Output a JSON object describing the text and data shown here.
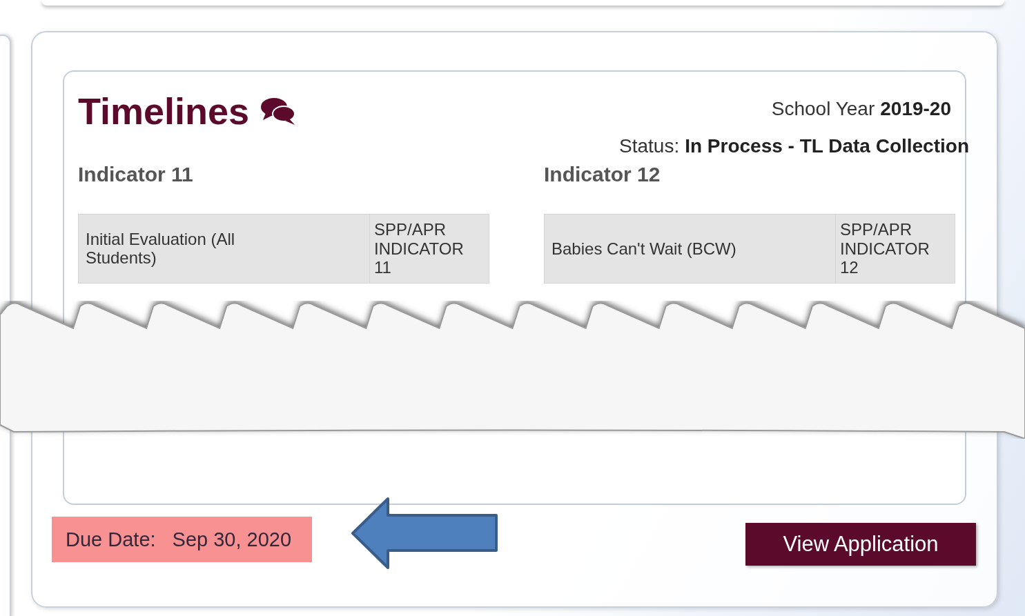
{
  "timelines": {
    "title": "Timelines",
    "school_year": {
      "label": "School Year",
      "value": "2019-20"
    },
    "status": {
      "label": "Status:",
      "value": "In Process - TL Data Collection"
    },
    "indicators": [
      {
        "title": "Indicator 11",
        "columns": [
          "Initial Evaluation (All Students)",
          "SPP/APR INDICATOR 11"
        ]
      },
      {
        "title": "Indicator 12",
        "columns": [
          "Babies Can't Wait (BCW)",
          "SPP/APR INDICATOR 12"
        ]
      }
    ]
  },
  "due_date": {
    "label": "Due Date:",
    "value": "Sep 30, 2020"
  },
  "button": "View Application"
}
